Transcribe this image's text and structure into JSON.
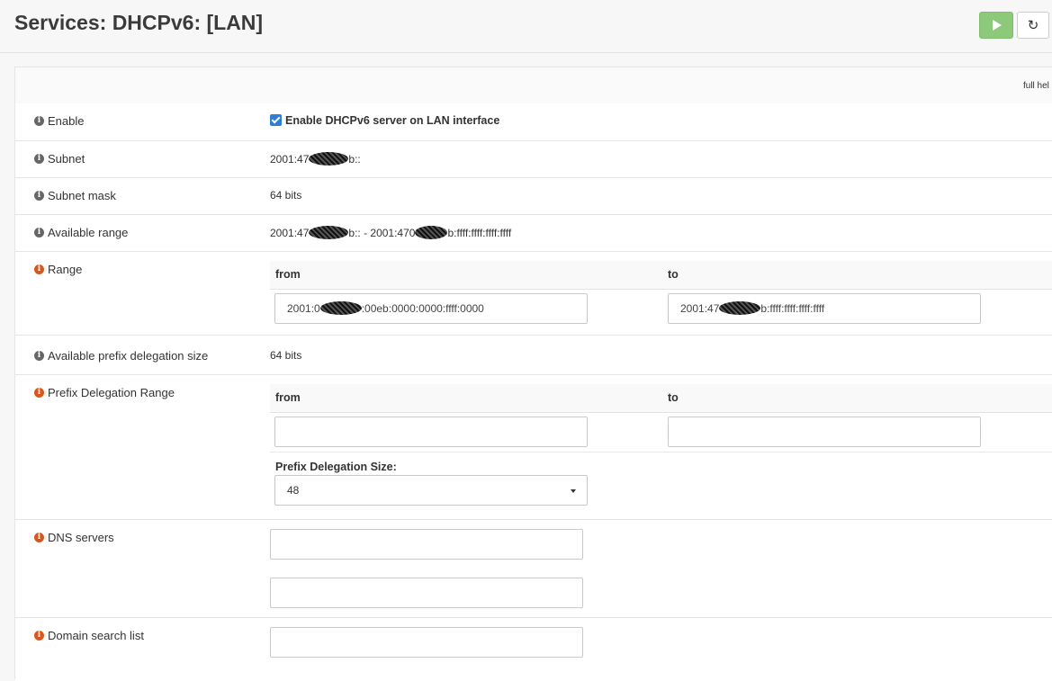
{
  "header": {
    "title": "Services: DHCPv6: [LAN]",
    "apply_icon": "play-icon",
    "reload_icon": "reload-icon",
    "reload_glyph": "↻"
  },
  "panel": {
    "full_help": "full hel"
  },
  "info_icon_glyph": "i",
  "rows": {
    "enable": {
      "label": "Enable",
      "checkbox_label": "Enable DHCPv6 server on LAN interface",
      "checked": true
    },
    "subnet": {
      "label": "Subnet",
      "value_pre": "2001:47",
      "value_post": "b::"
    },
    "subnet_mask": {
      "label": "Subnet mask",
      "value": "64 bits"
    },
    "available_range": {
      "label": "Available range",
      "part1": "2001:47",
      "part2": "b:: - 2001:470",
      "part3": "b:ffff:ffff:ffff:ffff"
    },
    "range": {
      "label": "Range",
      "from_header": "from",
      "to_header": "to",
      "from_pre": "2001:0",
      "from_post": ":00eb:0000:0000:ffff:0000",
      "to_pre": "2001:47",
      "to_post": "b:ffff:ffff:ffff:ffff"
    },
    "available_prefix": {
      "label": "Available prefix delegation size",
      "value": "64 bits"
    },
    "prefix_delegation": {
      "label": "Prefix Delegation Range",
      "from_header": "from",
      "to_header": "to",
      "from_value": "",
      "to_value": "",
      "size_label": "Prefix Delegation Size:",
      "size_value": "48"
    },
    "dns_servers": {
      "label": "DNS servers",
      "value1": "",
      "value2": ""
    },
    "domain_search": {
      "label": "Domain search list",
      "value": ""
    }
  }
}
